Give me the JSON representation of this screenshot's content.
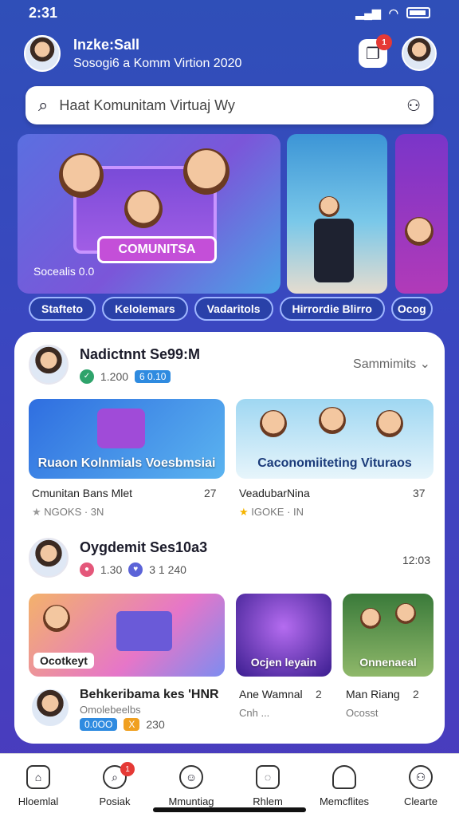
{
  "status": {
    "time": "2:31",
    "battery_icon": "battery-icon"
  },
  "header": {
    "name": "Inzke:Sall",
    "subtitle": "Sosogi6 a Komm Virtion 2020",
    "notif_count": "1"
  },
  "search": {
    "placeholder": "Haat Komunitam Virtuaj Wy"
  },
  "banner": {
    "pill_text": "COMUNITSA",
    "caption": "Socealis 0.0"
  },
  "chips": [
    "Stafteto",
    "Kelolemars",
    "Vadaritols",
    "Hirrordie Blirro",
    "Ocog"
  ],
  "section1": {
    "title": "Nadictnnt Se99:M",
    "meta_count": "1.200",
    "meta_tag": "6 0.10",
    "sort_label": "Sammimits",
    "tiles": [
      {
        "label": "Ruaon Kolnmials Voesbmsiai",
        "caption": "Cmunitan Bans Mlet",
        "sub": "NGOKS · 3N",
        "num": "27"
      },
      {
        "label": "Caconomiiteting Vituraos",
        "caption": "VeadubarNina",
        "sub": "IGOKE · IN",
        "num": "37"
      }
    ]
  },
  "section2": {
    "title": "Oygdemit Ses10a3",
    "meta_count": "1.30",
    "meta_tag": "3 1 240",
    "side_num": "12:03",
    "tiles": [
      {
        "label": "Ocotkeyt",
        "caption": "Behkeribama kes 'HNR",
        "num": ""
      },
      {
        "label": "Ocjen leyain",
        "caption": "Ane Wamnal",
        "num": "2",
        "sub": "Cnh ..."
      },
      {
        "label": "Onnenaeal",
        "caption": "Man Riang",
        "num": "2",
        "sub": "Ocosst"
      }
    ],
    "user_sub": "Omolebeelbs",
    "user_tag": "0.0OO",
    "user_num": "230"
  },
  "nav": [
    {
      "label": "Hloemlal",
      "icon": "home-icon"
    },
    {
      "label": "Posiak",
      "icon": "search-icon",
      "badge": "1"
    },
    {
      "label": "Mmuntiag",
      "icon": "smile-icon"
    },
    {
      "label": "Rhlem",
      "icon": "chat-icon"
    },
    {
      "label": "Memcflites",
      "icon": "bell-icon"
    },
    {
      "label": "Clearte",
      "icon": "profile-icon"
    }
  ]
}
